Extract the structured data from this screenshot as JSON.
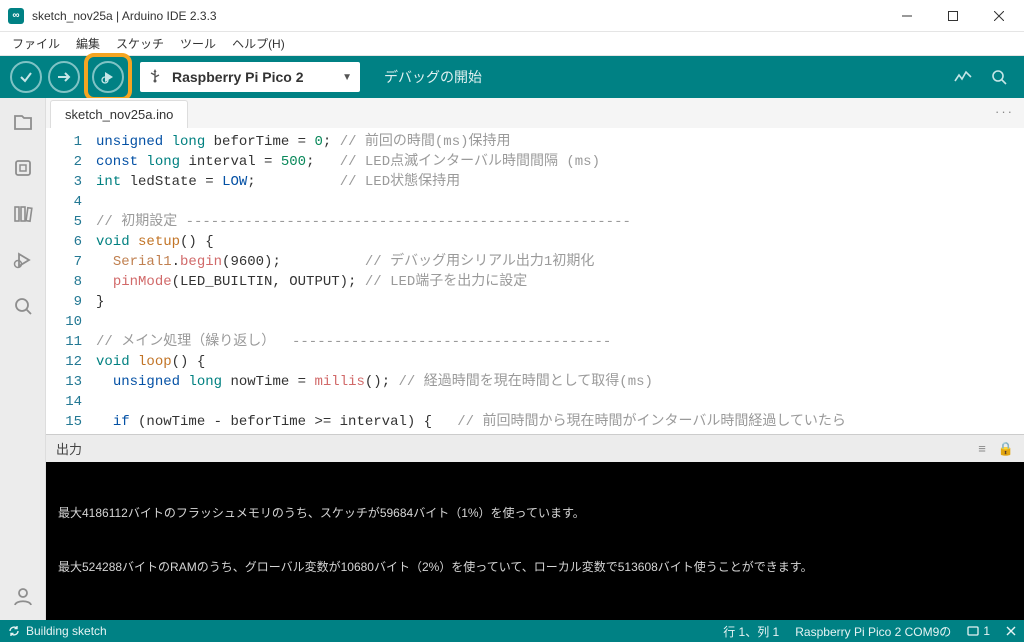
{
  "window": {
    "title": "sketch_nov25a | Arduino IDE 2.3.3"
  },
  "menu": {
    "file": "ファイル",
    "edit": "編集",
    "sketch": "スケッチ",
    "tools": "ツール",
    "help": "ヘルプ(H)"
  },
  "toolbar": {
    "board": "Raspberry Pi Pico 2",
    "debug_start": "デバッグの開始"
  },
  "tab": {
    "name": "sketch_nov25a.ino"
  },
  "lines": {
    "l1": {
      "n": "1",
      "t1": "unsigned",
      "t2": "long",
      "id": "beforTime",
      "op": " = ",
      "v": "0",
      "end": ";",
      "cm": " // 前回の時間(ms)保持用"
    },
    "l2": {
      "n": "2",
      "t1": "const",
      "t2": "long",
      "id": "interval",
      "op": " = ",
      "v": "500",
      "end": ";",
      "cm": "   // LED点滅インターバル時間間隔 (ms)"
    },
    "l3": {
      "n": "3",
      "t1": "int",
      "id": "ledState",
      "op": " = ",
      "v": "LOW",
      "end": ";",
      "cm": "          // LED状態保持用"
    },
    "l4": {
      "n": "4"
    },
    "l5": {
      "n": "5",
      "cm": "// 初期設定 -----------------------------------------------------"
    },
    "l6": {
      "n": "6",
      "t1": "void",
      "fn": "setup",
      "rest": "() {"
    },
    "l7": {
      "n": "7",
      "obj": "Serial1",
      "dot": ".",
      "fn": "begin",
      "args": "(9600);",
      "cm": "          // デバッグ用シリアル出力1初期化"
    },
    "l8": {
      "n": "8",
      "fn": "pinMode",
      "args": "(LED_BUILTIN, OUTPUT);",
      "cm": " // LED端子を出力に設定"
    },
    "l9": {
      "n": "9",
      "plain": "}"
    },
    "l10": {
      "n": "10"
    },
    "l11": {
      "n": "11",
      "cm": "// メイン処理（繰り返し）  --------------------------------------"
    },
    "l12": {
      "n": "12",
      "t1": "void",
      "fn": "loop",
      "rest": "() {"
    },
    "l13": {
      "n": "13",
      "t1": "unsigned",
      "t2": "long",
      "id": "nowTime",
      "op": " = ",
      "fn": "millis",
      "args": "();",
      "cm": " // 経過時間を現在時間として取得(ms)"
    },
    "l14": {
      "n": "14"
    },
    "l15": {
      "n": "15",
      "kw": "if",
      "rest": " (nowTime - beforTime >= interval) {",
      "cm": "   // 前回時間から現在時間がインターバル時間経過していたら"
    }
  },
  "output": {
    "title": "出力",
    "line1": "最大4186112バイトのフラッシュメモリのうち、スケッチが59684バイト（1%）を使っています。",
    "line2": "最大524288バイトのRAMのうち、グローバル変数が10680バイト（2%）を使っていて、ローカル変数で513608バイト使うことができます。"
  },
  "status": {
    "building": "Building sketch",
    "cursor": "行 1、列 1",
    "board": "Raspberry Pi Pico 2 COM9の",
    "notif": "1"
  }
}
